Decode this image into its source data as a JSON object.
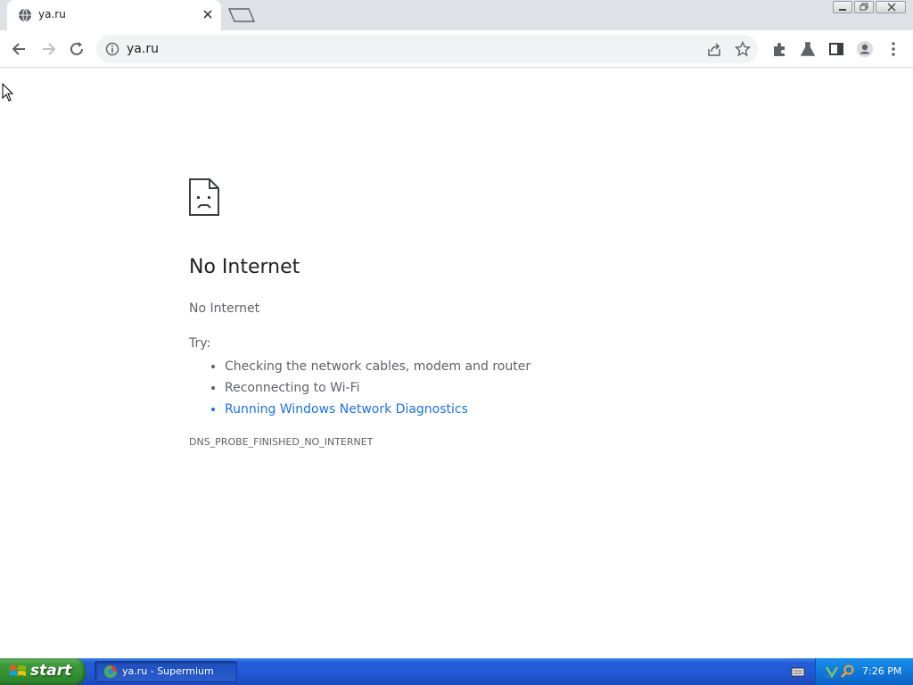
{
  "browser": {
    "tab": {
      "title": "ya.ru",
      "favicon": "globe-icon"
    },
    "address_bar": {
      "url": "ya.ru",
      "site_info_icon": "info-icon"
    },
    "toolbar_icons": [
      "back-icon",
      "forward-icon",
      "reload-icon",
      "share-icon",
      "star-icon",
      "extensions-icon",
      "flask-icon",
      "side-panel-icon",
      "profile-icon",
      "menu-icon"
    ]
  },
  "page": {
    "heading": "No Internet",
    "subtext": "No Internet",
    "try_label": "Try:",
    "suggestions": [
      "Checking the network cables, modem and router",
      "Reconnecting to Wi-Fi",
      "Running Windows Network Diagnostics"
    ],
    "error_code": "DNS_PROBE_FINISHED_NO_INTERNET"
  },
  "taskbar": {
    "start_label": "start",
    "task_label": "ya.ru - Supermium",
    "clock": "7:26 PM"
  },
  "colors": {
    "link": "#1a73e8",
    "taskbar": "#245edb",
    "start_button": "#3c9a3a"
  }
}
